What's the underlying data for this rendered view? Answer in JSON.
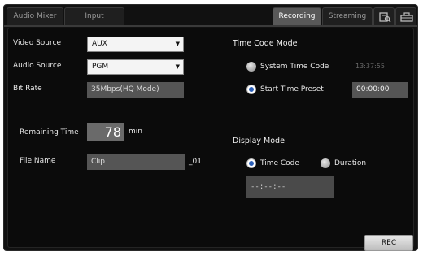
{
  "tabs": {
    "audio_mixer": "Audio Mixer",
    "input": "Input",
    "recording": "Recording",
    "streaming": "Streaming",
    "media_icon": "media-search-icon",
    "settings_icon": "toolbox-icon"
  },
  "left": {
    "video_source_label": "Video Source",
    "video_source_value": "AUX",
    "audio_source_label": "Audio Source",
    "audio_source_value": "PGM",
    "bit_rate_label": "Bit Rate",
    "bit_rate_value": "35Mbps(HQ Mode)",
    "remaining_time_label": "Remaining Time",
    "remaining_time_value": "78",
    "remaining_time_unit": "min",
    "file_name_label": "File Name",
    "file_name_value": "Clip",
    "file_name_suffix": "_01"
  },
  "right": {
    "time_code_mode_label": "Time Code Mode",
    "system_time_code_label": "System Time Code",
    "system_time_code_value": "13:37:55",
    "start_time_preset_label": "Start Time Preset",
    "start_time_preset_value": "00:00:00",
    "display_mode_label": "Display Mode",
    "time_code_option": "Time Code",
    "duration_option": "Duration",
    "display_value": "--:--:--"
  },
  "rec_button": "REC",
  "colors": {
    "selected_radio": "#2b5fb8",
    "active_tab": "#585858",
    "background": "#0b0b0b"
  }
}
